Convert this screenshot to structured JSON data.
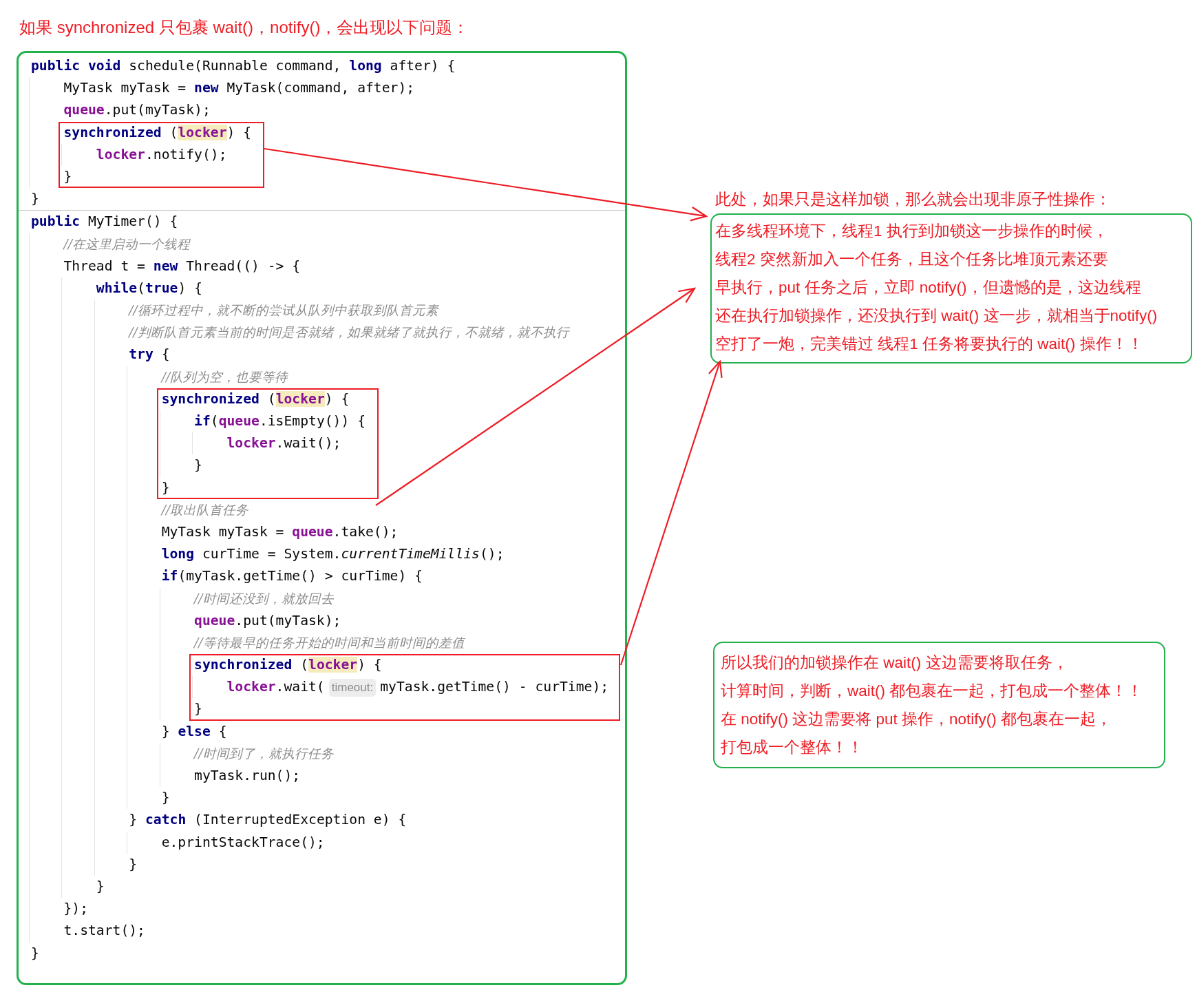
{
  "title": "如果 synchronized 只包裹 wait()，notify()，会出现以下问题：",
  "code": {
    "methods": [
      {
        "blocks": [
          {
            "highlighted": false,
            "lines": [
              {
                "tokens": [
                  {
                    "kind": "keyword",
                    "text": "public void"
                  },
                  {
                    "kind": "text",
                    "text": " schedule(Runnable command, "
                  },
                  {
                    "kind": "keyword",
                    "text": "long"
                  },
                  {
                    "kind": "text",
                    "text": " after) {"
                  }
                ]
              },
              {
                "tokens": [
                  {
                    "kind": "text",
                    "text": "    MyTask myTask = "
                  },
                  {
                    "kind": "keyword",
                    "text": "new"
                  },
                  {
                    "kind": "text",
                    "text": " MyTask(command, after);"
                  }
                ]
              },
              {
                "tokens": [
                  {
                    "kind": "field",
                    "text": "    queue"
                  },
                  {
                    "kind": "text",
                    "text": ".put(myTask);"
                  }
                ]
              }
            ]
          },
          {
            "highlighted": true,
            "lines": [
              {
                "tokens": [
                  {
                    "kind": "keyword",
                    "text": "    synchronized"
                  },
                  {
                    "kind": "text",
                    "text": " ("
                  },
                  {
                    "kind": "field-marked",
                    "text": "locker"
                  },
                  {
                    "kind": "text",
                    "text": ") {"
                  }
                ]
              },
              {
                "tokens": [
                  {
                    "kind": "field",
                    "text": "        locker"
                  },
                  {
                    "kind": "text",
                    "text": ".notify();"
                  }
                ]
              },
              {
                "tokens": [
                  {
                    "kind": "text",
                    "text": "    }"
                  }
                ]
              }
            ]
          },
          {
            "highlighted": false,
            "lines": [
              {
                "tokens": [
                  {
                    "kind": "text",
                    "text": "}"
                  }
                ]
              }
            ]
          }
        ]
      },
      {
        "blocks": [
          {
            "highlighted": false,
            "lines": [
              {
                "tokens": [
                  {
                    "kind": "keyword",
                    "text": "public"
                  },
                  {
                    "kind": "text",
                    "text": " MyTimer() {"
                  }
                ]
              },
              {
                "tokens": [
                  {
                    "kind": "comment",
                    "text": "    //在这里启动一个线程"
                  }
                ]
              },
              {
                "tokens": [
                  {
                    "kind": "text",
                    "text": "    Thread t = "
                  },
                  {
                    "kind": "keyword",
                    "text": "new"
                  },
                  {
                    "kind": "text",
                    "text": " Thread(() -> {"
                  }
                ]
              },
              {
                "tokens": [
                  {
                    "kind": "keyword",
                    "text": "        while"
                  },
                  {
                    "kind": "text",
                    "text": "("
                  },
                  {
                    "kind": "keyword",
                    "text": "true"
                  },
                  {
                    "kind": "text",
                    "text": ") {"
                  }
                ]
              },
              {
                "tokens": [
                  {
                    "kind": "comment",
                    "text": "            //循环过程中，就不断的尝试从队列中获取到队首元素"
                  }
                ]
              },
              {
                "tokens": [
                  {
                    "kind": "comment",
                    "text": "            //判断队首元素当前的时间是否就绪，如果就绪了就执行，不就绪，就不执行"
                  }
                ]
              },
              {
                "tokens": [
                  {
                    "kind": "keyword",
                    "text": "            try"
                  },
                  {
                    "kind": "text",
                    "text": " {"
                  }
                ]
              },
              {
                "tokens": [
                  {
                    "kind": "comment",
                    "text": "                //队列为空，也要等待"
                  }
                ]
              }
            ]
          },
          {
            "highlighted": true,
            "lines": [
              {
                "tokens": [
                  {
                    "kind": "keyword",
                    "text": "                synchronized"
                  },
                  {
                    "kind": "text",
                    "text": " ("
                  },
                  {
                    "kind": "field-marked",
                    "text": "locker"
                  },
                  {
                    "kind": "text",
                    "text": ") {"
                  }
                ]
              },
              {
                "tokens": [
                  {
                    "kind": "keyword",
                    "text": "                    if"
                  },
                  {
                    "kind": "text",
                    "text": "("
                  },
                  {
                    "kind": "field",
                    "text": "queue"
                  },
                  {
                    "kind": "text",
                    "text": ".isEmpty()) {"
                  }
                ]
              },
              {
                "tokens": [
                  {
                    "kind": "field",
                    "text": "                        locker"
                  },
                  {
                    "kind": "text",
                    "text": ".wait();"
                  }
                ]
              },
              {
                "tokens": [
                  {
                    "kind": "text",
                    "text": "                    }"
                  }
                ]
              },
              {
                "tokens": [
                  {
                    "kind": "text",
                    "text": "                }"
                  }
                ]
              }
            ]
          },
          {
            "highlighted": false,
            "lines": [
              {
                "tokens": [
                  {
                    "kind": "comment",
                    "text": "                //取出队首任务"
                  }
                ]
              },
              {
                "tokens": [
                  {
                    "kind": "text",
                    "text": "                MyTask myTask = "
                  },
                  {
                    "kind": "field",
                    "text": "queue"
                  },
                  {
                    "kind": "text",
                    "text": ".take();"
                  }
                ]
              },
              {
                "tokens": [
                  {
                    "kind": "keyword",
                    "text": "                long"
                  },
                  {
                    "kind": "text",
                    "text": " curTime = System."
                  },
                  {
                    "kind": "static",
                    "text": "currentTimeMillis"
                  },
                  {
                    "kind": "text",
                    "text": "();"
                  }
                ]
              },
              {
                "tokens": [
                  {
                    "kind": "keyword",
                    "text": "                if"
                  },
                  {
                    "kind": "text",
                    "text": "(myTask.getTime() > curTime) {"
                  }
                ]
              },
              {
                "tokens": [
                  {
                    "kind": "comment",
                    "text": "                    //时间还没到，就放回去"
                  }
                ]
              },
              {
                "tokens": [
                  {
                    "kind": "field",
                    "text": "                    queue"
                  },
                  {
                    "kind": "text",
                    "text": ".put(myTask);"
                  }
                ]
              },
              {
                "tokens": [
                  {
                    "kind": "comment",
                    "text": "                    //等待最早的任务开始的时间和当前时间的差值"
                  }
                ]
              }
            ]
          },
          {
            "highlighted": true,
            "lines": [
              {
                "tokens": [
                  {
                    "kind": "keyword",
                    "text": "                    synchronized"
                  },
                  {
                    "kind": "text",
                    "text": " ("
                  },
                  {
                    "kind": "field-marked",
                    "text": "locker"
                  },
                  {
                    "kind": "text",
                    "text": ") {"
                  }
                ]
              },
              {
                "tokens": [
                  {
                    "kind": "field",
                    "text": "                        locker"
                  },
                  {
                    "kind": "text",
                    "text": ".wait("
                  },
                  {
                    "kind": "hint",
                    "text": "timeout:"
                  },
                  {
                    "kind": "text",
                    "text": "myTask.getTime() - curTime);"
                  }
                ]
              },
              {
                "tokens": [
                  {
                    "kind": "text",
                    "text": "                    }"
                  }
                ]
              }
            ]
          },
          {
            "highlighted": false,
            "lines": [
              {
                "tokens": [
                  {
                    "kind": "text",
                    "text": "                } "
                  },
                  {
                    "kind": "keyword",
                    "text": "else"
                  },
                  {
                    "kind": "text",
                    "text": " {"
                  }
                ]
              },
              {
                "tokens": [
                  {
                    "kind": "comment",
                    "text": "                    //时间到了，就执行任务"
                  }
                ]
              },
              {
                "tokens": [
                  {
                    "kind": "text",
                    "text": "                    myTask.run();"
                  }
                ]
              },
              {
                "tokens": [
                  {
                    "kind": "text",
                    "text": "                }"
                  }
                ]
              },
              {
                "tokens": [
                  {
                    "kind": "text",
                    "text": "            } "
                  },
                  {
                    "kind": "keyword",
                    "text": "catch"
                  },
                  {
                    "kind": "text",
                    "text": " (InterruptedException e) {"
                  }
                ]
              },
              {
                "tokens": [
                  {
                    "kind": "text",
                    "text": "                e.printStackTrace();"
                  }
                ]
              },
              {
                "tokens": [
                  {
                    "kind": "text",
                    "text": "            }"
                  }
                ]
              },
              {
                "tokens": [
                  {
                    "kind": "text",
                    "text": "        }"
                  }
                ]
              },
              {
                "tokens": [
                  {
                    "kind": "text",
                    "text": "    });"
                  }
                ]
              },
              {
                "tokens": [
                  {
                    "kind": "text",
                    "text": "    t.start();"
                  }
                ]
              },
              {
                "tokens": [
                  {
                    "kind": "text",
                    "text": "}"
                  }
                ]
              }
            ]
          }
        ]
      }
    ]
  },
  "annotations": [
    {
      "heading": "此处，如果只是这样加锁，那么就会出现非原子性操作：",
      "lines": [
        "在多线程环境下，线程1 执行到加锁这一步操作的时候，",
        "线程2 突然新加入一个任务，且这个任务比堆顶元素还要",
        "早执行，put 任务之后，立即 notify()，但遗憾的是，这边线程",
        "还在执行加锁操作，还没执行到 wait() 这一步，就相当于notify()",
        "空打了一炮，完美错过 线程1 任务将要执行的 wait() 操作！！"
      ]
    },
    {
      "lines": [
        "所以我们的加锁操作在 wait() 这边需要将取任务，",
        "计算时间，判断，wait() 都包裹在一起，打包成一个整体！！",
        "在 notify() 这边需要将 put 操作，notify() 都包裹在一起，",
        "打包成一个整体！！"
      ]
    }
  ]
}
